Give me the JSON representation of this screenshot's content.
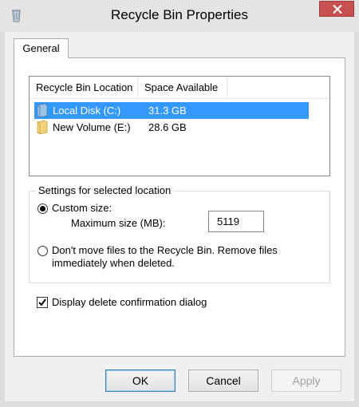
{
  "window": {
    "title": "Recycle Bin Properties",
    "close_icon": "close-x-icon",
    "app_icon": "recycle-bin-icon"
  },
  "tabs": [
    {
      "label": "General",
      "selected": true
    }
  ],
  "locations": {
    "columns": [
      "Recycle Bin Location",
      "Space Available",
      ""
    ],
    "rows": [
      {
        "name": "Local Disk (C:)",
        "space": "31.3 GB",
        "icon": "drive-icon",
        "selected": true
      },
      {
        "name": "New Volume (E:)",
        "space": "28.6 GB",
        "icon": "folder-drive-icon",
        "selected": false
      }
    ]
  },
  "settings": {
    "legend": "Settings for selected location",
    "custom_size_label": "Custom size:",
    "custom_size_selected": true,
    "max_size_label": "Maximum size (MB):",
    "max_size_value": "5119",
    "no_recycle_label_line1": "Don't move files to the Recycle Bin. Remove files",
    "no_recycle_label_line2": "immediately when deleted.",
    "no_recycle_selected": false
  },
  "confirm": {
    "label": "Display delete confirmation dialog",
    "checked": true
  },
  "buttons": {
    "ok": "OK",
    "cancel": "Cancel",
    "apply": "Apply"
  },
  "colors": {
    "selection": "#3399ff",
    "close_button": "#c75050",
    "window_frame": "#dcdcdc"
  }
}
